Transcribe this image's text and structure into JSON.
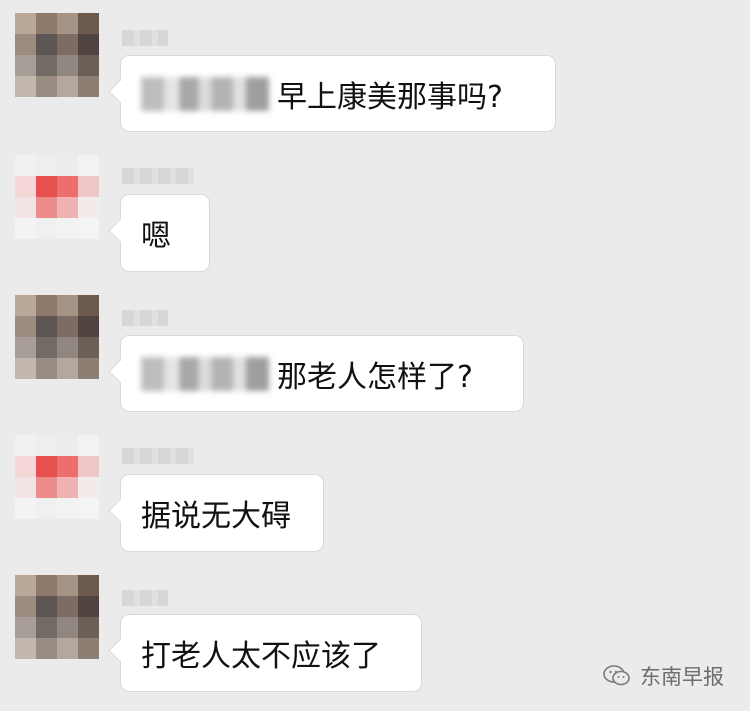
{
  "messages": [
    {
      "sender": "person-a",
      "has_redacted_prefix": true,
      "text": "早上康美那事吗?"
    },
    {
      "sender": "person-b",
      "has_redacted_prefix": false,
      "text": "嗯"
    },
    {
      "sender": "person-a",
      "has_redacted_prefix": true,
      "text": "那老人怎样了?"
    },
    {
      "sender": "person-b",
      "has_redacted_prefix": false,
      "text": "据说无大碍"
    },
    {
      "sender": "person-a",
      "has_redacted_prefix": false,
      "text": "打老人太不应该了"
    }
  ],
  "watermark": {
    "icon": "wechat-icon",
    "text": "东南早报"
  },
  "colors": {
    "background": "#ebebeb",
    "bubble": "#ffffff",
    "accent_b": "#e8504f"
  }
}
